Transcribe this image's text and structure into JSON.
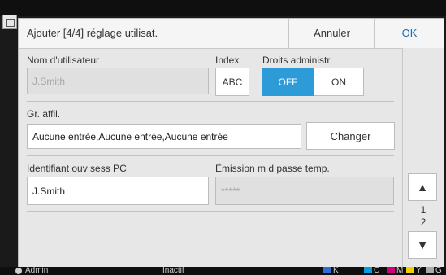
{
  "dialog": {
    "title": "Ajouter [4/4] réglage utilisat.",
    "cancel_label": "Annuler",
    "ok_label": "OK"
  },
  "form": {
    "username": {
      "label": "Nom d'utilisateur",
      "value": "J.Smith"
    },
    "index": {
      "label": "Index",
      "button_label": "ABC"
    },
    "admin_rights": {
      "label": "Droits administr.",
      "off_label": "OFF",
      "on_label": "ON",
      "selected": "OFF"
    },
    "group": {
      "label": "Gr. affil.",
      "value": "Aucune entrée,Aucune entrée,Aucune entrée",
      "change_label": "Changer"
    },
    "pc_login": {
      "label": "Identifiant ouv sess PC",
      "value": "J.Smith"
    },
    "temp_password": {
      "label": "Émission m d passe temp.",
      "value": "*****"
    }
  },
  "pager": {
    "current": "1",
    "total": "2",
    "up_icon": "triangle-up-icon",
    "down_icon": "triangle-down-icon"
  },
  "statusbar": {
    "user": "Admin",
    "state": "Inactif",
    "ink_labels": [
      "K",
      "C",
      "M",
      "Y",
      "G"
    ]
  },
  "colors": {
    "accent_selected": "#2d9bd8",
    "ok_text": "#1f6fae",
    "ink_cyan": "#00a0e0",
    "ink_magenta": "#d0007a",
    "ink_yellow": "#f0d000",
    "ink_gray": "#aaaaaa"
  }
}
